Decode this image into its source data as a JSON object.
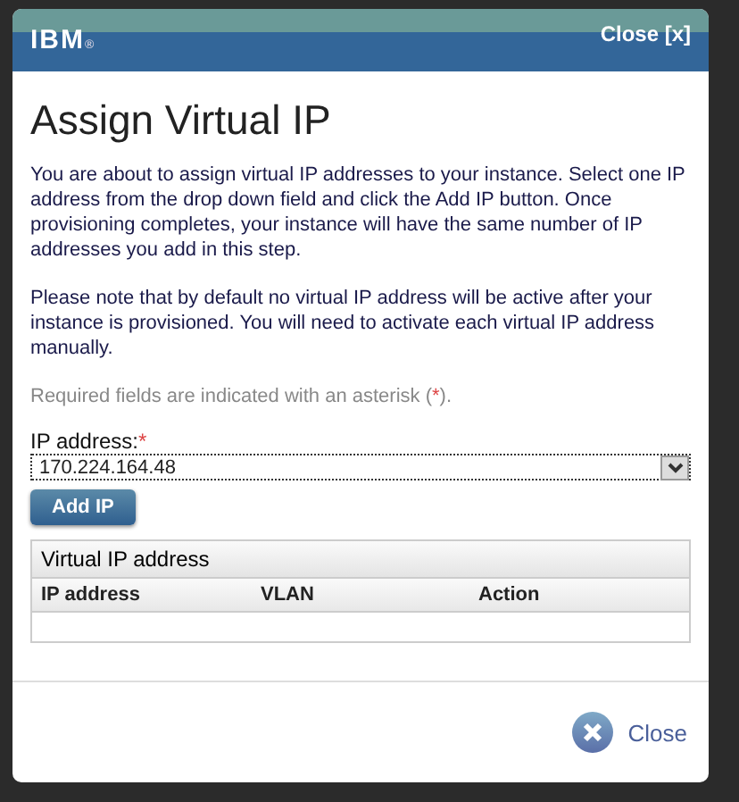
{
  "header": {
    "logo": "IBM",
    "logo_mark": "®",
    "close_link": "Close [x]"
  },
  "title": "Assign Virtual IP",
  "paragraphs": [
    "You are about to assign virtual IP addresses to your instance. Select one IP address from the drop down field and click the Add IP button. Once provisioning completes, your instance will have the same number of IP addresses you add in this step.",
    "Please note that by default no virtual IP address will be active after your instance is provisioned. You will need to activate each virtual IP address manually."
  ],
  "required_note": {
    "before": "Required fields are indicated with an asterisk (",
    "mark": "*",
    "after": ")."
  },
  "ip_field": {
    "label": "IP address:",
    "required_mark": "*",
    "value": "170.224.164.48"
  },
  "add_button": "Add IP",
  "table": {
    "title": "Virtual IP address",
    "columns": [
      "IP address",
      "VLAN",
      "Action"
    ]
  },
  "footer": {
    "close_button": "Close"
  }
}
